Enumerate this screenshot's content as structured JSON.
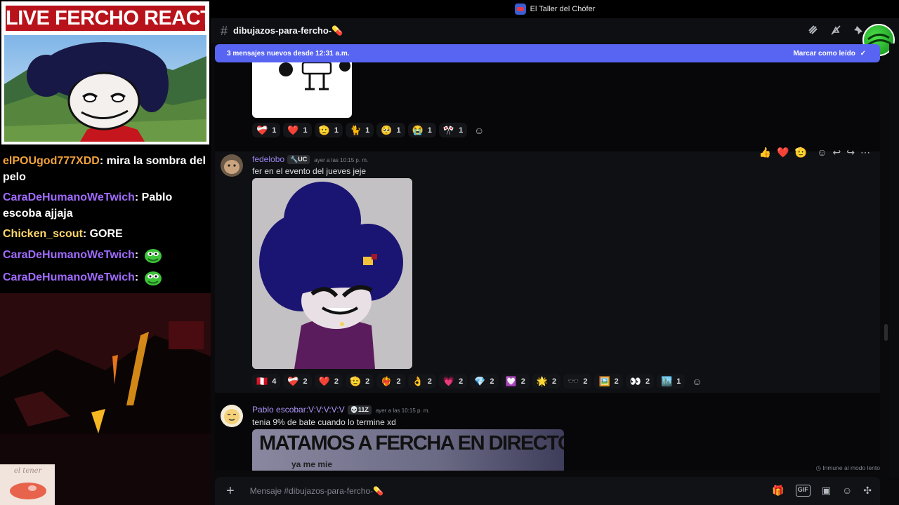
{
  "stream": {
    "banner_title": "LIVE FERCHO REACTION",
    "chat": [
      {
        "user": "elPOUgod777XDD",
        "user_color": "#f4a33b",
        "text": "mira la sombra del pelo"
      },
      {
        "user": "CaraDeHumanoWeTwich",
        "user_color": "#a06bff",
        "text": "Pablo escoba ajjaja"
      },
      {
        "user": "Chicken_scout",
        "user_color": "#ffd56b",
        "text": "GORE"
      },
      {
        "user": "CaraDeHumanoWeTwich",
        "user_color": "#a06bff",
        "text": "",
        "emote": "green-pepe-emote"
      },
      {
        "user": "CaraDeHumanoWeTwich",
        "user_color": "#a06bff",
        "text": "",
        "emote": "green-pepe-emote"
      }
    ],
    "webcam_label": "el tener"
  },
  "window": {
    "title": "El Taller del Chófer"
  },
  "channel": {
    "name": "dibujazos-para-fercho-💊",
    "header_icons": [
      "threads-icon",
      "mute-icon",
      "pin-icon"
    ]
  },
  "new_messages_banner": {
    "text": "3 mensajes nuevos desde 12:31 a.m.",
    "action": "Marcar como leído"
  },
  "messages": [
    {
      "id": "m0",
      "reactions": [
        {
          "emoji": "❤️‍🩹",
          "count": "1"
        },
        {
          "emoji": "❤️",
          "count": "1"
        },
        {
          "emoji": "🫡",
          "count": "1"
        },
        {
          "emoji": "🐈",
          "count": "1"
        },
        {
          "emoji": "🥺",
          "count": "1"
        },
        {
          "emoji": "😭",
          "count": "1"
        },
        {
          "emoji": "🎌",
          "count": "1"
        }
      ]
    },
    {
      "id": "m1",
      "author": "fedelobo",
      "author_color": "#9b84ee",
      "tag": "UC",
      "timestamp": "ayer a las 10:15 p. m.",
      "text": "fer en el evento del jueves jeje",
      "reactions": [
        {
          "emoji": "🇵🇪",
          "count": "4"
        },
        {
          "emoji": "❤️‍🩹",
          "count": "2"
        },
        {
          "emoji": "❤️",
          "count": "2"
        },
        {
          "emoji": "🫡",
          "count": "2"
        },
        {
          "emoji": "❤️‍🔥",
          "count": "2"
        },
        {
          "emoji": "👌",
          "count": "2"
        },
        {
          "emoji": "💗",
          "count": "2"
        },
        {
          "emoji": "💎",
          "count": "2"
        },
        {
          "emoji": "💟",
          "count": "2"
        },
        {
          "emoji": "🌟",
          "count": "2"
        },
        {
          "emoji": "🕶️",
          "count": "2"
        },
        {
          "emoji": "🖼️",
          "count": "2"
        },
        {
          "emoji": "👀",
          "count": "2"
        },
        {
          "emoji": "🏙️",
          "count": "1"
        }
      ]
    },
    {
      "id": "m2",
      "author": "Pablo escobar:V:V:V:V:V",
      "author_color": "#b197fc",
      "tag": "11Z",
      "timestamp": "ayer a las 10:15 p. m.",
      "text": "tenia 9% de bate cuando lo termine xd",
      "image_caption": "MATAMOS A FERCHA EN DIRECTO",
      "image_subcaption": "ya me mie"
    }
  ],
  "hover_toolbar": [
    "👍",
    "❤️",
    "🫡"
  ],
  "slowmode_text": "Inmune al modo lento",
  "composer": {
    "placeholder": "Mensaje #dibujazos-para-fercho-💊"
  }
}
